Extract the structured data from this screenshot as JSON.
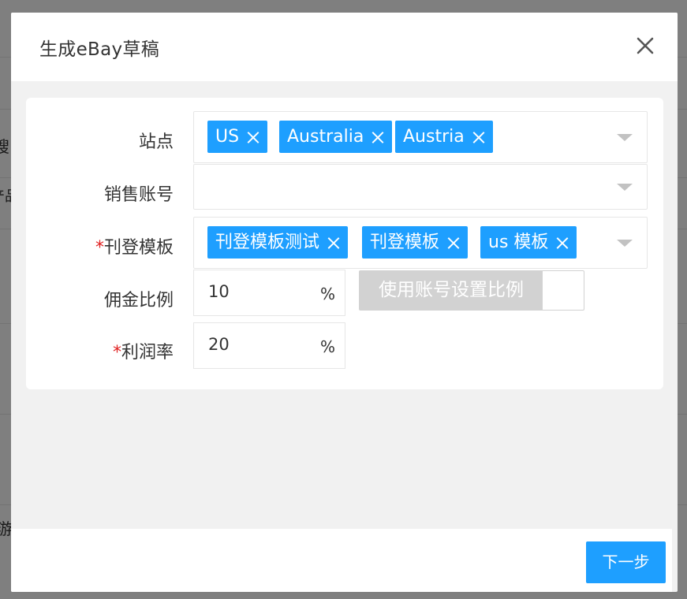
{
  "background": {
    "fragments": [
      "搜",
      "产品",
      "游"
    ]
  },
  "modal": {
    "title": "生成eBay草稿",
    "close_icon": "close-icon"
  },
  "form": {
    "site": {
      "label": "站点",
      "tags": [
        "US",
        "Australia",
        "Austria"
      ]
    },
    "account": {
      "label": "销售账号",
      "tags": []
    },
    "template": {
      "label": "刊登模板",
      "required": true,
      "tags": [
        "刊登模板测试",
        "刊登模板",
        "us 模板"
      ]
    },
    "commission": {
      "label": "佣金比例",
      "value": "10",
      "unit": "%",
      "switch_label": "使用账号设置比例"
    },
    "profit": {
      "label": "利润率",
      "required": true,
      "value": "20",
      "unit": "%"
    }
  },
  "footer": {
    "next_label": "下一步"
  },
  "colors": {
    "accent": "#1e9fff",
    "required": "#e02020",
    "disabled": "#d2d2d2"
  }
}
